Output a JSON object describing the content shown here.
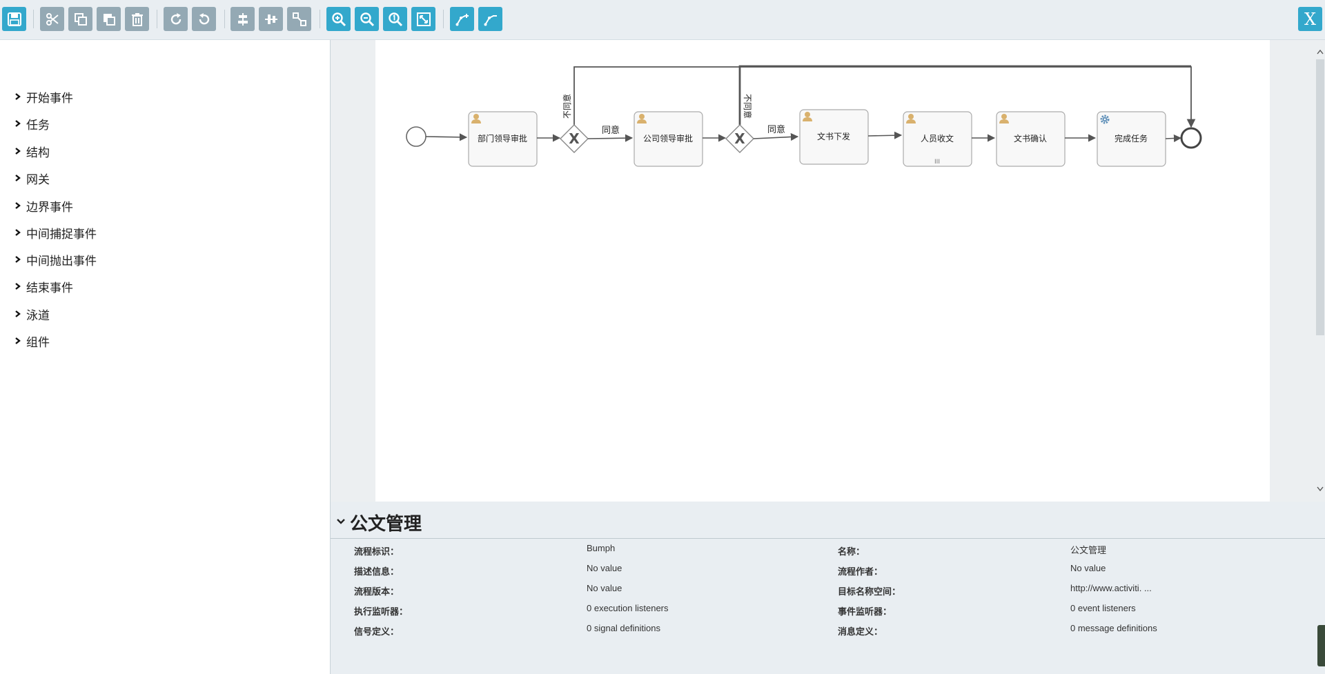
{
  "toolbar": {
    "buttons": [
      {
        "icon": "save-icon",
        "color": "blue"
      },
      {
        "icon": "cut-icon",
        "color": "gray"
      },
      {
        "icon": "copy-icon",
        "color": "gray"
      },
      {
        "icon": "paste-icon",
        "color": "gray"
      },
      {
        "icon": "delete-icon",
        "color": "gray"
      },
      {
        "icon": "redo-icon",
        "color": "gray"
      },
      {
        "icon": "undo-icon",
        "color": "gray"
      },
      {
        "icon": "align-vertical-icon",
        "color": "gray"
      },
      {
        "icon": "align-horizontal-icon",
        "color": "gray"
      },
      {
        "icon": "same-size-icon",
        "color": "gray"
      },
      {
        "icon": "zoom-in-icon",
        "color": "blue"
      },
      {
        "icon": "zoom-out-icon",
        "color": "blue"
      },
      {
        "icon": "zoom-actual-icon",
        "color": "blue"
      },
      {
        "icon": "zoom-fit-icon",
        "color": "blue"
      },
      {
        "icon": "add-bendpoint-icon",
        "color": "blue"
      },
      {
        "icon": "remove-bendpoint-icon",
        "color": "blue"
      }
    ],
    "close_label": "X",
    "colors": {
      "blue": "#33a8cc",
      "gray": "#94a9b4"
    }
  },
  "palette": {
    "items": [
      {
        "label": "开始事件"
      },
      {
        "label": "任务"
      },
      {
        "label": "结构"
      },
      {
        "label": "网关"
      },
      {
        "label": "边界事件"
      },
      {
        "label": "中间捕捉事件"
      },
      {
        "label": "中间抛出事件"
      },
      {
        "label": "结束事件"
      },
      {
        "label": "泳道"
      },
      {
        "label": "组件"
      }
    ]
  },
  "diagram": {
    "tasks": [
      {
        "label": "部门领导审批",
        "icon": "user-icon"
      },
      {
        "label": "公司领导审批",
        "icon": "user-icon"
      },
      {
        "label": "文书下发",
        "icon": "user-icon"
      },
      {
        "label": "人员收文",
        "icon": "user-icon",
        "marker": "III"
      },
      {
        "label": "文书确认",
        "icon": "user-icon"
      },
      {
        "label": "完成任务",
        "icon": "service-gear-icon"
      }
    ],
    "flow_labels": {
      "agree_1": "同意",
      "agree_2": "同意",
      "disagree_1": "不同意",
      "disagree_2": "不同意"
    },
    "gateway_symbol": "X"
  },
  "properties": {
    "title": "公文管理",
    "left": [
      {
        "label": "流程标识：",
        "value": "Bumph"
      },
      {
        "label": "描述信息：",
        "value": "No value"
      },
      {
        "label": "流程版本：",
        "value": "No value"
      },
      {
        "label": "执行监听器：",
        "value": "0 execution listeners"
      },
      {
        "label": "信号定义：",
        "value": "0 signal definitions"
      }
    ],
    "right": [
      {
        "label": "名称：",
        "value": "公文管理"
      },
      {
        "label": "流程作者：",
        "value": "No value"
      },
      {
        "label": "目标名称空间：",
        "value": "http://www.activiti. ..."
      },
      {
        "label": "事件监听器：",
        "value": "0 event listeners"
      },
      {
        "label": "消息定义：",
        "value": "0 message definitions"
      }
    ]
  }
}
